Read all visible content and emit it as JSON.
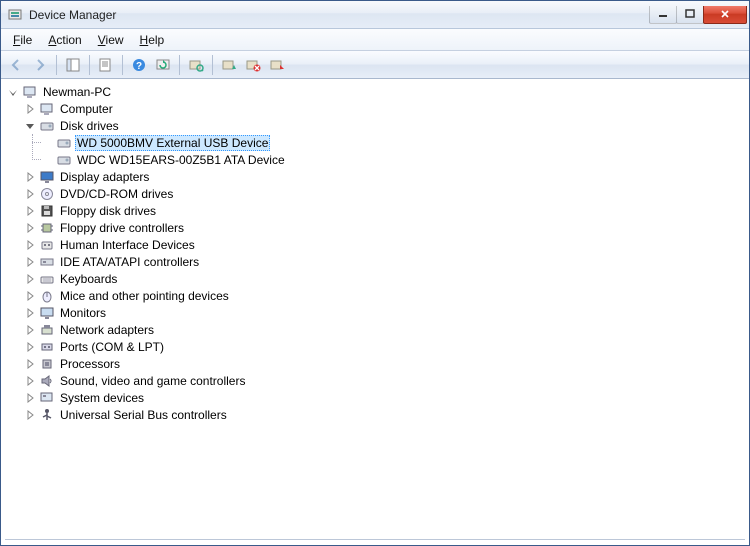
{
  "window": {
    "title": "Device Manager"
  },
  "menus": {
    "file": "File",
    "action": "Action",
    "view": "View",
    "help": "Help"
  },
  "toolbar": {
    "back": "Back",
    "forward": "Forward",
    "show_hide": "Show/Hide Console Tree",
    "properties": "Properties",
    "help": "Help",
    "refresh": "Refresh",
    "scan": "Scan for hardware changes",
    "update": "Update Driver Software",
    "uninstall": "Uninstall",
    "disable": "Disable"
  },
  "tree": {
    "root": "Newman-PC",
    "categories": [
      {
        "label": "Computer",
        "icon": "computer"
      },
      {
        "label": "Disk drives",
        "icon": "disk",
        "expanded": true,
        "children": [
          {
            "label": "WD 5000BMV External USB Device",
            "selected": true
          },
          {
            "label": "WDC WD15EARS-00Z5B1 ATA Device",
            "selected": false
          }
        ]
      },
      {
        "label": "Display adapters",
        "icon": "display"
      },
      {
        "label": "DVD/CD-ROM drives",
        "icon": "dvd"
      },
      {
        "label": "Floppy disk drives",
        "icon": "floppy"
      },
      {
        "label": "Floppy drive controllers",
        "icon": "chip"
      },
      {
        "label": "Human Interface Devices",
        "icon": "hid"
      },
      {
        "label": "IDE ATA/ATAPI controllers",
        "icon": "ide"
      },
      {
        "label": "Keyboards",
        "icon": "keyboard"
      },
      {
        "label": "Mice and other pointing devices",
        "icon": "mouse"
      },
      {
        "label": "Monitors",
        "icon": "monitor"
      },
      {
        "label": "Network adapters",
        "icon": "network"
      },
      {
        "label": "Ports (COM & LPT)",
        "icon": "port"
      },
      {
        "label": "Processors",
        "icon": "cpu"
      },
      {
        "label": "Sound, video and game controllers",
        "icon": "sound"
      },
      {
        "label": "System devices",
        "icon": "system"
      },
      {
        "label": "Universal Serial Bus controllers",
        "icon": "usb"
      }
    ]
  }
}
